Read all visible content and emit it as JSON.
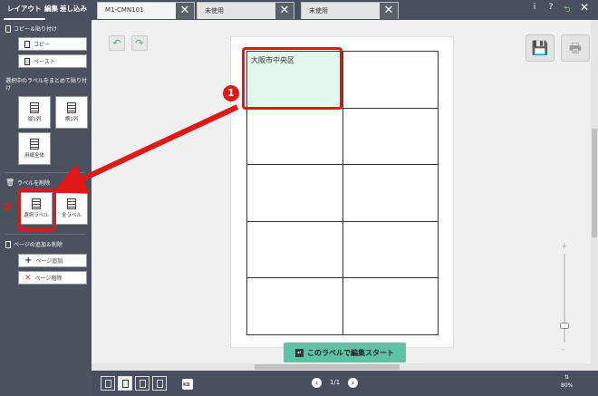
{
  "top_tabs": [
    "レイアウト",
    "編集",
    "差し込み"
  ],
  "file_tabs": [
    {
      "title": "M1-CMN101"
    },
    {
      "title": "未使用"
    },
    {
      "title": "未使用"
    }
  ],
  "top_icons": {
    "info": "i",
    "help": "?"
  },
  "sidebar": {
    "copy_paste": {
      "title": "コピー＆貼り付け",
      "copy": "コピー",
      "paste": "ペースト"
    },
    "bulk_paste": {
      "title": "選択中のラベルをまとめて貼り付け",
      "vertical": "縦1列",
      "horizontal": "横1列",
      "whole": "用紙全体"
    },
    "delete_labels": {
      "title": "ラベルを削除",
      "selected": "選択ラベル",
      "all": "全ラベル"
    },
    "pages": {
      "title": "ページの追加＆削除",
      "add": "ページ追加",
      "delete": "ページ削除"
    }
  },
  "canvas": {
    "selected_label_text": "大阪市中央区",
    "start_button": "このラベルで編集スタート",
    "grid_rows": 5,
    "grid_cols": 2
  },
  "bottom": {
    "page_indicator": "1/1",
    "zoom": "80%",
    "kb": "KB"
  },
  "annotations": {
    "badge1": "1",
    "badge2": "2"
  },
  "colors": {
    "accent_red": "#e01818",
    "start_button": "#5ec2a4",
    "selected_cell": "#e3f7ed"
  }
}
